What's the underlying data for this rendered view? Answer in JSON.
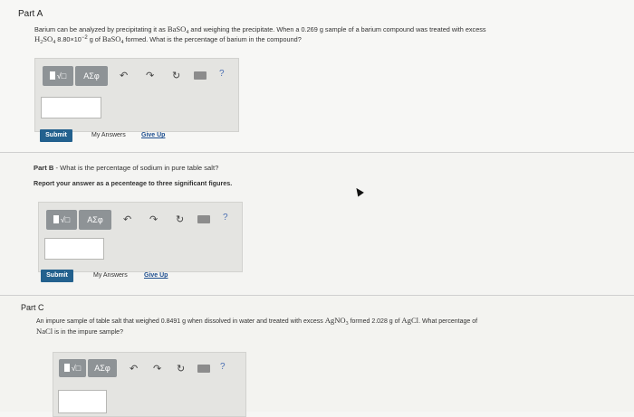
{
  "part_a": {
    "title": "Part A",
    "line1_a": "Barium can be analyzed by precipitating it as ",
    "line1_b": " and weighing the precipitate. When a ",
    "line1_c": "0.269 g",
    "line1_d": " sample of a barium compound was treated with excess",
    "line2_a": " 8.80×10",
    "line2_exp": "−2",
    "line2_b": " g of ",
    "line2_c": " formed. What is the percentage of barium in the compound?",
    "submit": "Submit",
    "my_answers": "My Answers",
    "give_up": "Give Up"
  },
  "part_b": {
    "title_bold": "Part B",
    "title_rest": " - What is the percentage of sodium in pure table salt?",
    "instruction": "Report your answer as a pecenteage to three significant figures.",
    "submit": "Submit",
    "my_answers": "My Answers",
    "give_up": "Give Up"
  },
  "part_c": {
    "title": "Part C",
    "line1_a": "An impure sample of table salt that weighed ",
    "line1_b": "0.8491 g",
    "line1_c": " when dissolved in water and treated with excess ",
    "line1_d": " formed ",
    "line1_e": "2.028 g",
    "line1_f": " of ",
    "line1_g": ". What percentage of",
    "line2": " is in the impure sample?"
  },
  "toolbar": {
    "template_label": "√□",
    "greek_label": "ΑΣφ",
    "undo_icon": "↶",
    "redo_icon": "↷",
    "reset_icon": "↻",
    "help_label": "?"
  },
  "chem": {
    "ba": "Ba",
    "so": "SO",
    "four": "4",
    "h": "H",
    "two": "2",
    "ag": "Ag",
    "no": "NO",
    "three": "3",
    "cl": "Cl",
    "na": "Na"
  }
}
